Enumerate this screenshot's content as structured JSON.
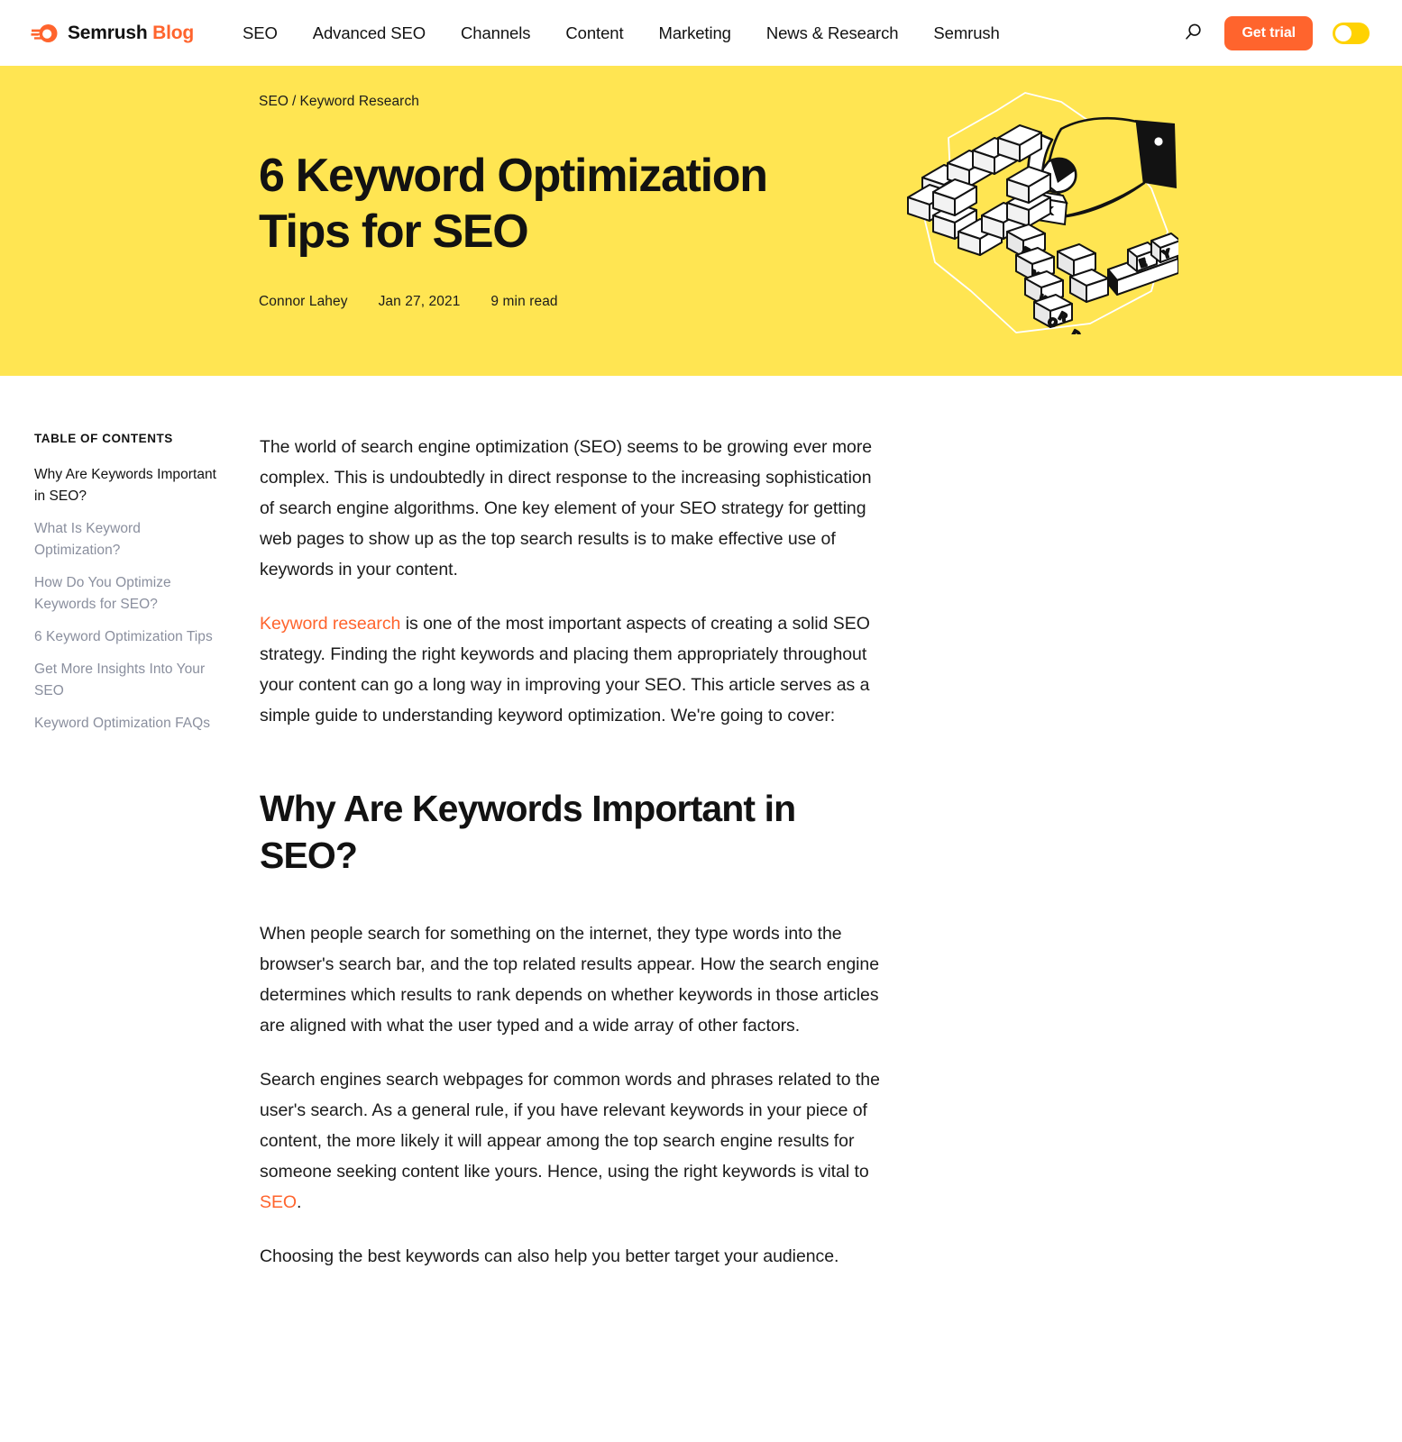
{
  "header": {
    "brand": {
      "name": "Semrush",
      "suffix": "Blog",
      "icon": "semrush-comet-logo"
    },
    "nav": [
      {
        "label": "SEO"
      },
      {
        "label": "Advanced SEO"
      },
      {
        "label": "Channels"
      },
      {
        "label": "Content"
      },
      {
        "label": "Marketing"
      },
      {
        "label": "News & Research"
      },
      {
        "label": "Semrush"
      }
    ],
    "search_icon": "search-icon",
    "cta_label": "Get trial",
    "theme_toggle_icon": "theme-toggle",
    "accent_color": "#ff642d",
    "toggle_color": "#ffd202"
  },
  "hero": {
    "breadcrumb": {
      "category": "SEO",
      "separator": "/",
      "subcategory": "Keyword Research"
    },
    "title": "6 Keyword Optimization Tips for SEO",
    "author": "Connor Lahey",
    "date": "Jan 27, 2021",
    "read_time": "9 min read",
    "background_color": "#ffe552",
    "illustration": "keyword-tiles-hand-illustration"
  },
  "toc": {
    "heading": "TABLE OF CONTENTS",
    "items": [
      {
        "label": "Why Are Keywords Important in SEO?",
        "active": true
      },
      {
        "label": "What Is Keyword Optimization?",
        "active": false
      },
      {
        "label": "How Do You Optimize Keywords for SEO?",
        "active": false
      },
      {
        "label": "6 Keyword Optimization Tips",
        "active": false
      },
      {
        "label": "Get More Insights Into Your SEO",
        "active": false
      },
      {
        "label": "Keyword Optimization FAQs",
        "active": false
      }
    ]
  },
  "article": {
    "intro_paragraph": "The world of search engine optimization (SEO) seems to be growing ever more complex. This is undoubtedly in direct response to the increasing sophistication of search engine algorithms. One key element of your SEO strategy for getting web pages to show up as the top search results is to make effective use of keywords in your content.",
    "second_paragraph": {
      "link_text": "Keyword research",
      "rest": " is one of the most important aspects of creating a solid SEO strategy. Finding the right keywords and placing them appropriately throughout your content can go a long way in improving your SEO. This article serves as a simple guide to understanding keyword optimization. We're going to cover:"
    },
    "section_heading": "Why Are Keywords Important in SEO?",
    "body_paragraph_1": "When people search for something on the internet, they type words into the browser's search bar, and the top related results appear. How the search engine determines which results to rank depends on whether keywords in those articles are aligned with what the user typed and a wide array of other factors.",
    "body_paragraph_2": {
      "before": "Search engines search webpages for common words and phrases related to the user's search. As a general rule, if you have relevant keywords in your piece of content, the more likely it will appear among the top search engine results for someone seeking content like yours. Hence, using the right keywords is vital to ",
      "link_text": "SEO",
      "after": "."
    },
    "body_paragraph_3": "Choosing the best keywords can also help you better target your audience."
  }
}
